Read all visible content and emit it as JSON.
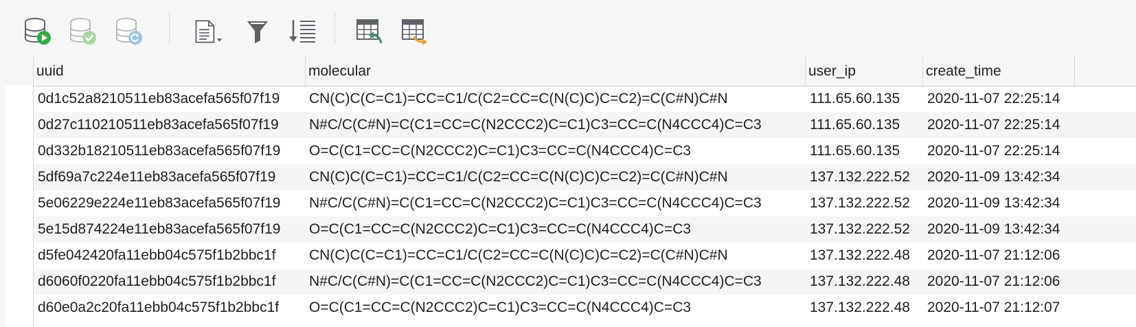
{
  "toolbar": {
    "buttons": [
      {
        "name": "run-query-button",
        "icon": "database-play-icon"
      },
      {
        "name": "commit-button",
        "icon": "database-check-icon"
      },
      {
        "name": "rollback-button",
        "icon": "database-refresh-icon"
      },
      {
        "name": "export-button",
        "icon": "document-dropdown-icon"
      },
      {
        "name": "filter-button",
        "icon": "filter-icon"
      },
      {
        "name": "sort-button",
        "icon": "sort-descending-icon"
      },
      {
        "name": "import-table-button",
        "icon": "table-import-icon"
      },
      {
        "name": "export-table-button",
        "icon": "table-export-icon"
      }
    ]
  },
  "table": {
    "columns": [
      "uuid",
      "molecular",
      "user_ip",
      "create_time"
    ],
    "rows": [
      {
        "uuid": "0d1c52a8210511eb83acefa565f07f19",
        "molecular": "CN(C)C(C=C1)=CC=C1/C(C2=CC=C(N(C)C)C=C2)=C(C#N)C#N",
        "user_ip": "111.65.60.135",
        "create_time": "2020-11-07 22:25:14"
      },
      {
        "uuid": "0d27c110210511eb83acefa565f07f19",
        "molecular": "N#C/C(C#N)=C(C1=CC=C(N2CCC2)C=C1)C3=CC=C(N4CCC4)C=C3",
        "user_ip": "111.65.60.135",
        "create_time": "2020-11-07 22:25:14"
      },
      {
        "uuid": "0d332b18210511eb83acefa565f07f19",
        "molecular": "O=C(C1=CC=C(N2CCC2)C=C1)C3=CC=C(N4CCC4)C=C3",
        "user_ip": "111.65.60.135",
        "create_time": "2020-11-07 22:25:14"
      },
      {
        "uuid": "5df69a7c224e11eb83acefa565f07f19",
        "molecular": "CN(C)C(C=C1)=CC=C1/C(C2=CC=C(N(C)C)C=C2)=C(C#N)C#N",
        "user_ip": "137.132.222.52",
        "create_time": "2020-11-09 13:42:34"
      },
      {
        "uuid": "5e06229e224e11eb83acefa565f07f19",
        "molecular": "N#C/C(C#N)=C(C1=CC=C(N2CCC2)C=C1)C3=CC=C(N4CCC4)C=C3",
        "user_ip": "137.132.222.52",
        "create_time": "2020-11-09 13:42:34"
      },
      {
        "uuid": "5e15d874224e11eb83acefa565f07f19",
        "molecular": "O=C(C1=CC=C(N2CCC2)C=C1)C3=CC=C(N4CCC4)C=C3",
        "user_ip": "137.132.222.52",
        "create_time": "2020-11-09 13:42:34"
      },
      {
        "uuid": "d5fe042420fa11ebb04c575f1b2bbc1f",
        "molecular": "CN(C)C(C=C1)=CC=C1/C(C2=CC=C(N(C)C)C=C2)=C(C#N)C#N",
        "user_ip": "137.132.222.48",
        "create_time": "2020-11-07 21:12:06"
      },
      {
        "uuid": "d6060f0220fa11ebb04c575f1b2bbc1f",
        "molecular": "N#C/C(C#N)=C(C1=CC=C(N2CCC2)C=C1)C3=CC=C(N4CCC4)C=C3",
        "user_ip": "137.132.222.48",
        "create_time": "2020-11-07 21:12:06"
      },
      {
        "uuid": "d60e0a2c20fa11ebb04c575f1b2bbc1f",
        "molecular": "O=C(C1=CC=C(N2CCC2)C=C1)C3=CC=C(N4CCC4)C=C3",
        "user_ip": "137.132.222.48",
        "create_time": "2020-11-07 21:12:07"
      }
    ]
  },
  "colors": {
    "run_green": "#3aa84a",
    "check_green": "#a7d9a0",
    "refresh_blue": "#9dc2e0",
    "icon_gray": "#5f6368",
    "import_green": "#3d8f6a",
    "export_orange": "#e8a23a"
  }
}
